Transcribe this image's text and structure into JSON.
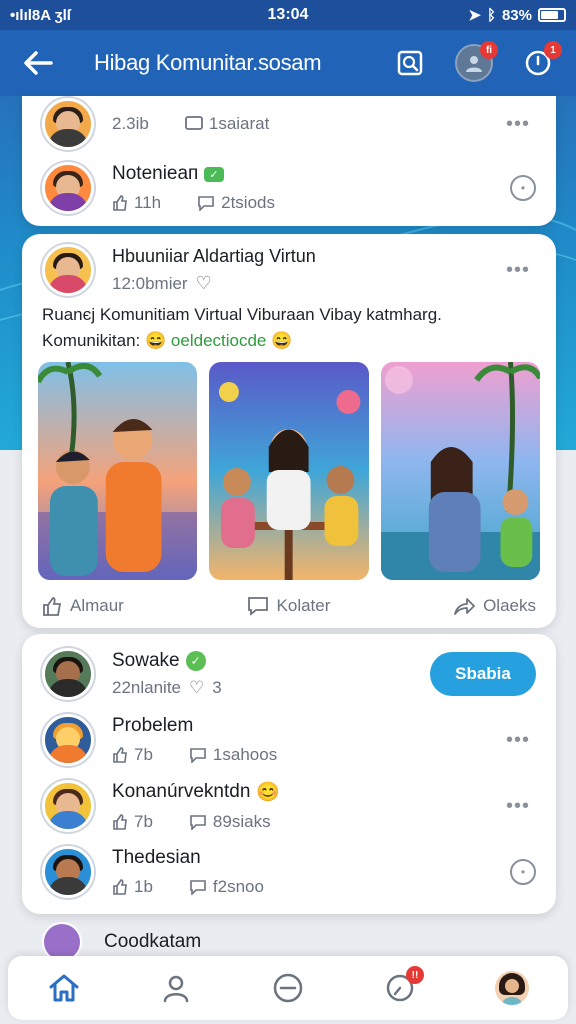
{
  "status_bar": {
    "left": "•ılıl8A ʒlſ",
    "time": "13:04",
    "battery": "83%"
  },
  "header": {
    "title": "Hibag Komunitar.sosam",
    "notif_badge": "fi",
    "alert_badge": "1"
  },
  "top_card": {
    "items": [
      {
        "name": "",
        "likes": "2.3ib",
        "comments": "1saiarat"
      },
      {
        "name": "Notenieaп",
        "likes": "11h",
        "comments": "2tsiods"
      }
    ]
  },
  "post": {
    "author": "Hbuuniiar Aldartiag Virtun",
    "time": "12:0bmier",
    "text_line1": "Ruanєj Komunitiam Virtual Viburaan Vibay katmharg.",
    "text_line2": "Komunikitan:",
    "hashtag": "oeldectiocde",
    "actions": {
      "like": "Almaur",
      "comment": "Kolater",
      "share": "Olaeks"
    }
  },
  "suggest_card": {
    "featured": {
      "name": "Sowake",
      "time": "22nlanite",
      "count": "3",
      "follow_label": "Sbabia"
    },
    "items": [
      {
        "name": "Probelem",
        "likes": "7b",
        "comments": "1sahoos"
      },
      {
        "name": "Konanúrvekntdn",
        "likes": "7b",
        "comments": "89siaks"
      },
      {
        "name": "Thedesian",
        "likes": "1b",
        "comments": "f2snoo"
      }
    ]
  },
  "peek": {
    "name": "Coodkatam"
  },
  "colors": {
    "header": "#2163b6",
    "accent": "#27a0df",
    "badge": "#e53935",
    "home_active": "#2a6fc4"
  }
}
